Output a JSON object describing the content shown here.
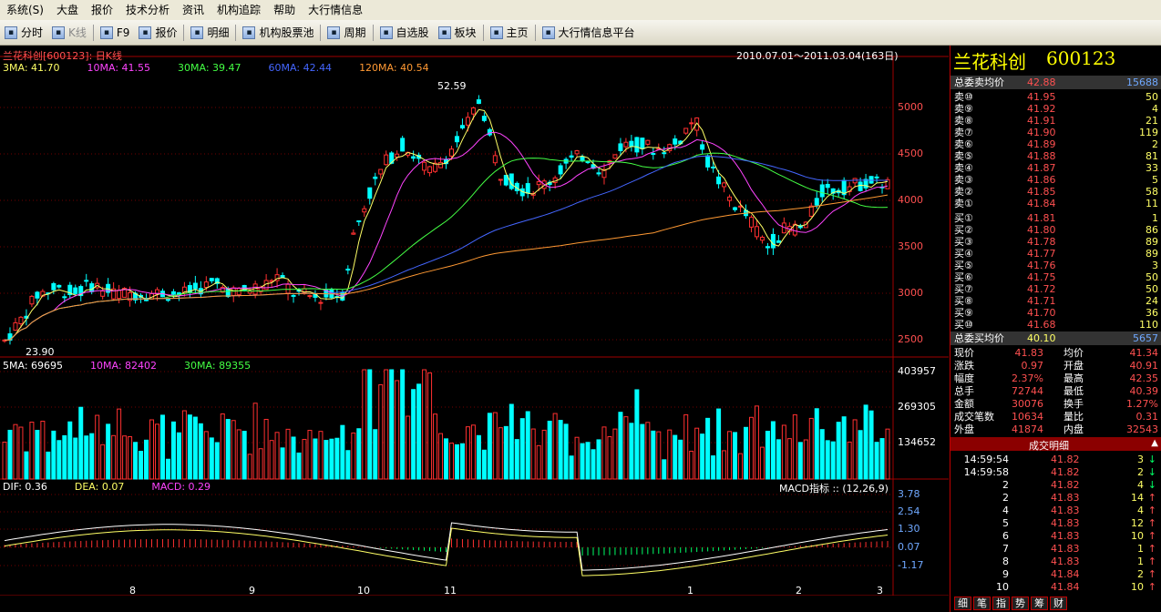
{
  "menu": [
    "系统(S)",
    "大盘",
    "报价",
    "技术分析",
    "资讯",
    "机构追踪",
    "帮助",
    "大行情信息"
  ],
  "toolbar": [
    {
      "label": "分时",
      "disabled": false
    },
    {
      "label": "K线",
      "disabled": true
    },
    {
      "label": "F9",
      "disabled": false
    },
    {
      "label": "报价",
      "disabled": false
    },
    {
      "label": "明细",
      "disabled": false
    },
    {
      "label": "机构股票池",
      "disabled": false
    },
    {
      "label": "周期",
      "disabled": false
    },
    {
      "label": "自选股",
      "disabled": false
    },
    {
      "label": "板块",
      "disabled": false
    },
    {
      "label": "主页",
      "disabled": false
    },
    {
      "label": "大行情信息平台",
      "disabled": false
    }
  ],
  "chart": {
    "title": "兰花科创[600123]: 日K线",
    "range": "2010.07.01～2011.03.04(163日)",
    "ma_legend": [
      {
        "label": "3MA: 41.70",
        "color": "#ffff66"
      },
      {
        "label": "10MA: 41.55",
        "color": "#ff44ff"
      },
      {
        "label": "30MA: 39.47",
        "color": "#44ff44"
      },
      {
        "label": "60MA: 42.44",
        "color": "#4466ff"
      },
      {
        "label": "120MA: 40.54",
        "color": "#ff9933"
      }
    ],
    "price_ticks": [
      "5000",
      "4500",
      "4000",
      "3500",
      "3000",
      "2500"
    ],
    "high_label": "52.59",
    "low_label": "23.90",
    "vol_legend": [
      {
        "label": "5MA: 69695",
        "color": "#ffffff"
      },
      {
        "label": "10MA: 82402",
        "color": "#ff44ff"
      },
      {
        "label": "30MA: 89355",
        "color": "#44ff44"
      }
    ],
    "vol_ticks": [
      "403957",
      "269305",
      "134652"
    ],
    "macd_legend": [
      {
        "label": "DIF: 0.36",
        "color": "#ffffff"
      },
      {
        "label": "DEA: 0.07",
        "color": "#ffff66"
      },
      {
        "label": "MACD: 0.29",
        "color": "#ff44ff"
      }
    ],
    "macd_name": "MACD指标 ::  (12,26,9)",
    "macd_ticks": [
      "3.78",
      "2.54",
      "1.30",
      "0.07",
      "-1.17"
    ],
    "x_labels": [
      "8",
      "9",
      "10",
      "11",
      "1",
      "2",
      "3"
    ]
  },
  "quote": {
    "name": "兰花科创",
    "code": "600123",
    "sell_avg_label": "总委卖均价",
    "sell_avg": "42.88",
    "sell_total": "15688",
    "asks": [
      {
        "label": "卖⑩",
        "price": "41.95",
        "vol": "50"
      },
      {
        "label": "卖⑨",
        "price": "41.92",
        "vol": "4"
      },
      {
        "label": "卖⑧",
        "price": "41.91",
        "vol": "21"
      },
      {
        "label": "卖⑦",
        "price": "41.90",
        "vol": "119"
      },
      {
        "label": "卖⑥",
        "price": "41.89",
        "vol": "2"
      },
      {
        "label": "卖⑤",
        "price": "41.88",
        "vol": "81"
      },
      {
        "label": "卖④",
        "price": "41.87",
        "vol": "33"
      },
      {
        "label": "卖③",
        "price": "41.86",
        "vol": "5"
      },
      {
        "label": "卖②",
        "price": "41.85",
        "vol": "58"
      },
      {
        "label": "卖①",
        "price": "41.84",
        "vol": "11"
      }
    ],
    "bids": [
      {
        "label": "买①",
        "price": "41.81",
        "vol": "1"
      },
      {
        "label": "买②",
        "price": "41.80",
        "vol": "86"
      },
      {
        "label": "买③",
        "price": "41.78",
        "vol": "89"
      },
      {
        "label": "买④",
        "price": "41.77",
        "vol": "89"
      },
      {
        "label": "买⑤",
        "price": "41.76",
        "vol": "3"
      },
      {
        "label": "买⑥",
        "price": "41.75",
        "vol": "50"
      },
      {
        "label": "买⑦",
        "price": "41.72",
        "vol": "50"
      },
      {
        "label": "买⑧",
        "price": "41.71",
        "vol": "24"
      },
      {
        "label": "买⑨",
        "price": "41.70",
        "vol": "36"
      },
      {
        "label": "买⑩",
        "price": "41.68",
        "vol": "110"
      }
    ],
    "buy_avg_label": "总委买均价",
    "buy_avg": "40.10",
    "buy_total": "5657",
    "stats": [
      {
        "l1": "现价",
        "v1": "41.83",
        "l2": "均价",
        "v2": "41.34"
      },
      {
        "l1": "涨跌",
        "v1": "0.97",
        "l2": "开盘",
        "v2": "40.91"
      },
      {
        "l1": "幅度",
        "v1": "2.37%",
        "l2": "最高",
        "v2": "42.35"
      },
      {
        "l1": "总手",
        "v1": "72744",
        "l2": "最低",
        "v2": "40.39"
      },
      {
        "l1": "金额",
        "v1": "30076",
        "l2": "换手",
        "v2": "1.27%"
      },
      {
        "l1": "成交笔数",
        "v1": "10634",
        "l2": "量比",
        "v2": "0.31"
      },
      {
        "l1": "外盘",
        "v1": "41874",
        "l2": "内盘",
        "v2": "32543"
      }
    ],
    "detail_title": "成交明细",
    "trades": [
      {
        "t": "14:59:54",
        "p": "41.82",
        "v": "3",
        "d": "↓"
      },
      {
        "t": "14:59:58",
        "p": "41.82",
        "v": "2",
        "d": "↓"
      },
      {
        "t": "2",
        "p": "41.82",
        "v": "4",
        "d": "↓"
      },
      {
        "t": "2",
        "p": "41.83",
        "v": "14",
        "d": "↑"
      },
      {
        "t": "4",
        "p": "41.83",
        "v": "4",
        "d": "↑"
      },
      {
        "t": "5",
        "p": "41.83",
        "v": "12",
        "d": "↑"
      },
      {
        "t": "6",
        "p": "41.83",
        "v": "10",
        "d": "↑"
      },
      {
        "t": "7",
        "p": "41.83",
        "v": "1",
        "d": "↑"
      },
      {
        "t": "8",
        "p": "41.83",
        "v": "1",
        "d": "↑"
      },
      {
        "t": "9",
        "p": "41.84",
        "v": "2",
        "d": "↑"
      },
      {
        "t": "10",
        "p": "41.84",
        "v": "10",
        "d": "↑"
      }
    ],
    "tabs": [
      "细",
      "笔",
      "指",
      "势",
      "筹",
      "财"
    ]
  },
  "colors": {
    "up": "#ff3030",
    "down": "#00ffff",
    "text": "#e0e0e0",
    "axis": "#ff3030"
  }
}
